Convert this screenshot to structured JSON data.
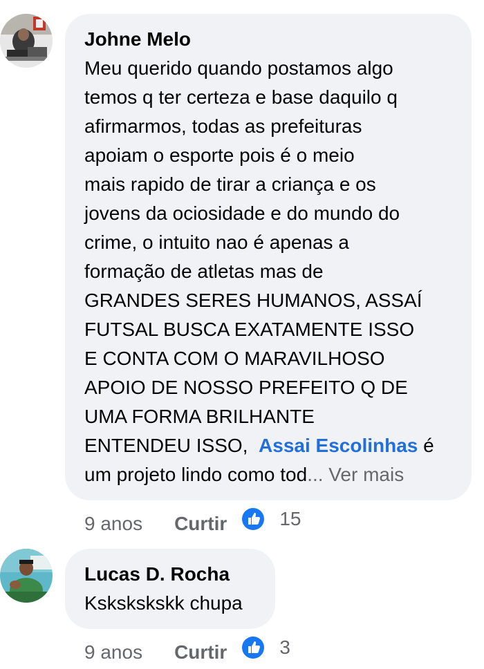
{
  "comments": [
    {
      "author": "Johne Melo",
      "text_lines": [
        "Meu querido quando postamos algo",
        "temos q ter certeza e base  daquilo q",
        "afirmarmos, todas as prefeituras",
        "apoiam o esporte  pois é  o meio",
        "mais rapido de tirar a criança  e os",
        "jovens da ociosidade  e do mundo do",
        "crime, o intuito  nao é  apenas a",
        "formação  de atletas mas de",
        "GRANDES SERES HUMANOS, ASSAÍ",
        "FUTSAL BUSCA EXATAMENTE  ISSO",
        "E CONTA COM O MARAVILHOSO",
        "APOIO DE NOSSO PREFEITO Q DE",
        "UMA FORMA BRILHANTE"
      ],
      "line_entendeu_prefix": "ENTENDEU ISSO,  ",
      "mention": "Assai Escolinhas",
      "line_entendeu_suffix": " é",
      "last_line": "um projeto lindo como tod",
      "see_more": "... Ver mais",
      "time": "9 anos",
      "like_label": "Curtir",
      "reaction_count": "15",
      "reaction_icon": "like-icon"
    },
    {
      "author": "Lucas D. Rocha",
      "text": "Kskskskskk chupa",
      "time": "9 anos",
      "like_label": "Curtir",
      "reaction_count": "3",
      "reaction_icon": "like-icon"
    }
  ],
  "colors": {
    "bubble": "#f0f2f5",
    "text": "#050505",
    "meta": "#65676b",
    "link": "#216fdb",
    "like": "#1877f2"
  }
}
